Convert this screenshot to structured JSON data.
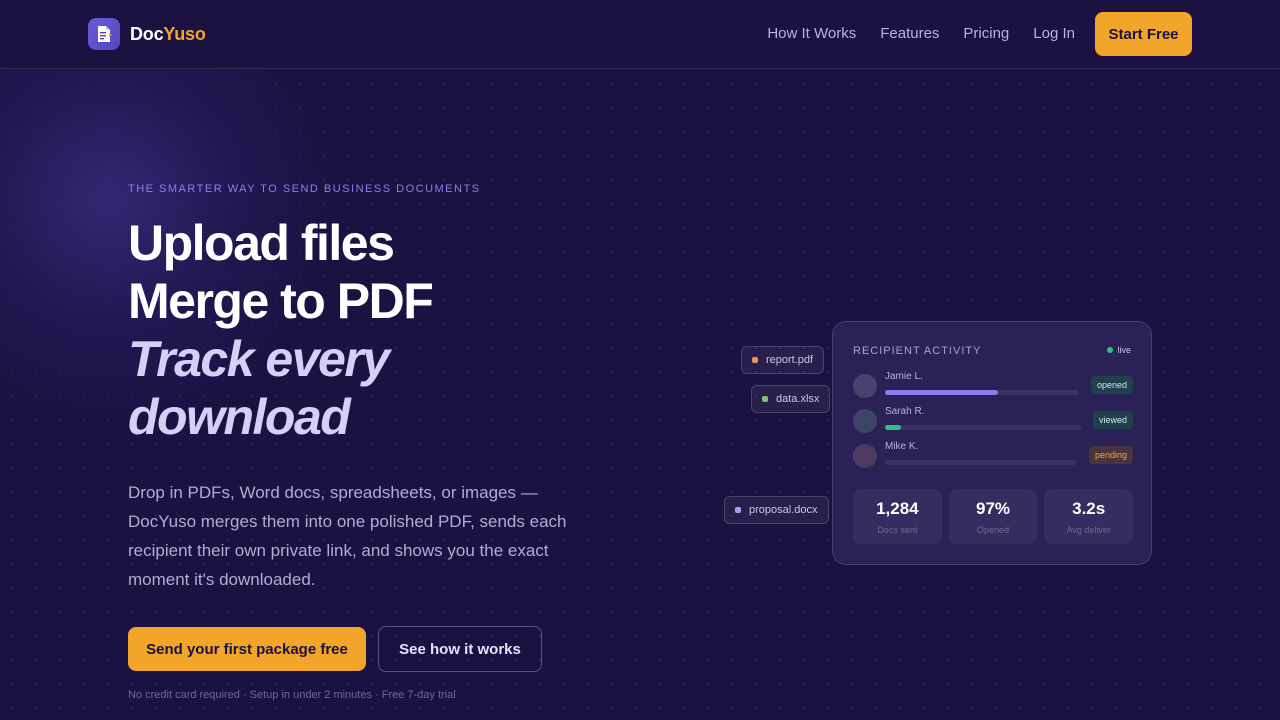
{
  "brand": {
    "name_part1": "Doc",
    "name_part2": "Yuso",
    "accent": "#f2a52b",
    "logo_icon": "document-arrow-icon"
  },
  "nav": {
    "links": [
      "How It Works",
      "Features",
      "Pricing",
      "Log In"
    ],
    "cta": "Start Free"
  },
  "hero": {
    "eyebrow": "THE SMARTER WAY TO SEND BUSINESS DOCUMENTS",
    "line1": "Upload files",
    "line2": "Merge to PDF",
    "line3": "Track every",
    "line4": "download",
    "description": "Drop in PDFs, Word docs, spreadsheets, or images — DocYuso merges them into one polished PDF, sends each recipient their own private link, and shows you the exact moment it's downloaded.",
    "cta_primary": "Send your first package free",
    "cta_secondary": "See how it works",
    "fineprint": "No credit card required · Setup in under 2 minutes · Free 7-day trial"
  },
  "files": [
    {
      "name": "report.pdf",
      "color": "#e8955a"
    },
    {
      "name": "data.xlsx",
      "color": "#7ec26a"
    },
    {
      "name": "proposal.docx",
      "color": "#a99ff0"
    }
  ],
  "activity": {
    "title": "RECIPIENT ACTIVITY",
    "live": "live",
    "recipients": [
      {
        "name": "Jamie L.",
        "progress": 0.58,
        "status": "opened",
        "color": "#8b7cf0",
        "avatar_color": "#4a426e",
        "badge_bg": "#21404e",
        "badge_fg": "#cde8f0"
      },
      {
        "name": "Sarah R.",
        "progress": 0.08,
        "status": "viewed",
        "color": "#2ec27e",
        "avatar_color": "#3e4468",
        "badge_bg": "#21404e",
        "badge_fg": "#cde8f0"
      },
      {
        "name": "Mike K.",
        "progress": 0.0,
        "status": "pending",
        "color": "#f2a52b",
        "avatar_color": "#4f3b60",
        "badge_bg": "#4a3440",
        "badge_fg": "#f2a52b"
      }
    ],
    "stats": [
      {
        "value": "1,284",
        "label": "Docs sent"
      },
      {
        "value": "97%",
        "label": "Opened"
      },
      {
        "value": "3.2s",
        "label": "Avg deliver"
      }
    ]
  }
}
